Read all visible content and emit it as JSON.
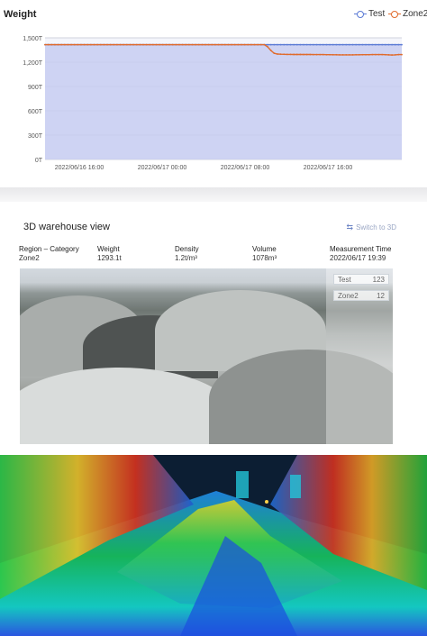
{
  "chart_section": {
    "title": "Weight",
    "legend": [
      {
        "label": "Test",
        "color": "#5b7bd5"
      },
      {
        "label": "Zone2",
        "color": "#e06b2c"
      }
    ]
  },
  "chart_data": {
    "type": "area",
    "title": "Weight",
    "yticks": [
      "0T",
      "300T",
      "600T",
      "900T",
      "1,200T",
      "1,500T"
    ],
    "ylim": [
      0,
      1500
    ],
    "xticks": [
      "2022/06/16 16:00",
      "2022/06/17 00:00",
      "2022/06/17 08:00",
      "2022/06/17 16:00"
    ],
    "grid": true,
    "legend_position": "top-right",
    "series": [
      {
        "name": "Test",
        "color": "#5b7bd5",
        "values": [
          1415,
          1415,
          1415,
          1415,
          1415,
          1415,
          1415,
          1415,
          1415,
          1415,
          1415,
          1415,
          1415,
          1415,
          1415,
          1415,
          1415,
          1415,
          1415,
          1415,
          1415,
          1415,
          1415,
          1415,
          1415,
          1415,
          1415,
          1415,
          1415,
          1415,
          1415,
          1415,
          1415,
          1415,
          1415,
          1415,
          1415,
          1415,
          1415,
          1415,
          1415,
          1415,
          1415,
          1415,
          1415,
          1415,
          1415,
          1415,
          1415,
          1415,
          1415,
          1415,
          1415,
          1415,
          1415,
          1415,
          1415,
          1415,
          1415,
          1415,
          1415,
          1415,
          1415,
          1415,
          1415,
          1415,
          1415,
          1415,
          1415,
          1415,
          1415,
          1415,
          1415,
          1415,
          1415,
          1415,
          1415,
          1415,
          1415,
          1415,
          1415,
          1415,
          1415,
          1415,
          1415,
          1415,
          1415,
          1415,
          1415,
          1415,
          1415,
          1415,
          1415,
          1415,
          1415,
          1415,
          1415,
          1415,
          1415,
          1415,
          1415,
          1415,
          1415,
          1415,
          1415,
          1415,
          1415,
          1415,
          1415,
          1415
        ]
      },
      {
        "name": "Zone2",
        "color": "#e06b2c",
        "values": [
          1415,
          1415,
          1415,
          1415,
          1415,
          1415,
          1415,
          1415,
          1415,
          1415,
          1415,
          1415,
          1415,
          1415,
          1415,
          1415,
          1415,
          1415,
          1415,
          1415,
          1415,
          1415,
          1415,
          1415,
          1415,
          1415,
          1415,
          1415,
          1415,
          1415,
          1415,
          1415,
          1415,
          1415,
          1415,
          1415,
          1415,
          1415,
          1415,
          1415,
          1415,
          1415,
          1415,
          1415,
          1415,
          1415,
          1415,
          1415,
          1415,
          1415,
          1415,
          1415,
          1415,
          1415,
          1415,
          1415,
          1415,
          1415,
          1415,
          1415,
          1415,
          1415,
          1415,
          1415,
          1415,
          1415,
          1415,
          1415,
          1390,
          1345,
          1310,
          1300,
          1298,
          1297,
          1296,
          1296,
          1295,
          1295,
          1295,
          1294,
          1294,
          1294,
          1293,
          1293,
          1293,
          1293,
          1292,
          1292,
          1291,
          1291,
          1290,
          1290,
          1290,
          1290,
          1290,
          1291,
          1291,
          1292,
          1292,
          1292,
          1293,
          1293,
          1293,
          1293,
          1292,
          1290,
          1288,
          1290,
          1293,
          1293
        ]
      }
    ]
  },
  "warehouse_view": {
    "title": "3D warehouse view",
    "switch_label": "Switch to 3D",
    "switch_icon": "swap-icon",
    "columns": [
      {
        "header": "Region – Category",
        "value": "Zone2"
      },
      {
        "header": "Weight",
        "value": "1293.1t"
      },
      {
        "header": "Density",
        "value": "1.2t/m³"
      },
      {
        "header": "Volume",
        "value": "1078m³"
      },
      {
        "header": "Measurement Time",
        "value": "2022/06/17 19:39"
      }
    ],
    "overlay": {
      "chip1_label": "Test",
      "chip1_value": "123",
      "chip2_label": "Zone2",
      "chip2_value": "12"
    }
  }
}
